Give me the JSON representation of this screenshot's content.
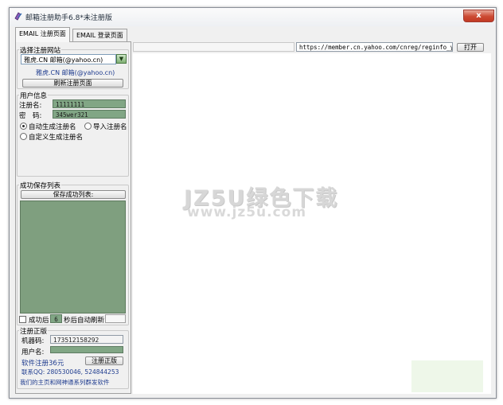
{
  "window": {
    "title": "邮箱注册助手6.8*未注册版",
    "close_label": "x"
  },
  "tabs": [
    {
      "label": "EMAIL 注册页面",
      "active": true
    },
    {
      "label": "EMAIL 登录页面",
      "active": false
    }
  ],
  "site_section": {
    "legend": "选择注册网站",
    "selected_site": "雅虎.CN 邮箱(@yahoo.cn)",
    "current_site_label": "雅虎.CN 邮箱(@yahoo.cn)",
    "refresh_button": "刷新注册页面"
  },
  "user_section": {
    "legend": "用户信息",
    "username_label": "注册名:",
    "username_value": "11111111",
    "password_label": "密　码:",
    "password_value": "345wer321",
    "radio_auto": "自动生成注册名",
    "radio_import": "导入注册名",
    "radio_custom": "自定义生成注册名",
    "selected_radio": "auto"
  },
  "save_section": {
    "legend": "成功保存列表",
    "save_button": "保存成功列表:",
    "auto_refresh_prefix": "成功后",
    "auto_refresh_seconds": "6",
    "auto_refresh_suffix": "秒后自动刷新",
    "auto_refresh_checked": false
  },
  "license_section": {
    "legend": "注册正版",
    "machine_code_label": "机器码:",
    "machine_code_value": "173512158292",
    "user_name_label": "用户名:",
    "user_name_value": "",
    "price_text": "软件注册36元",
    "register_button": "注册正版",
    "qq_text": "联系QQ: 280530046, 524844253",
    "homepage_link": "我们的主页和网神通系列群发软件"
  },
  "browser": {
    "url": "https://member.cn.yahoo.com/cnreg/reginfo_ycn.html",
    "open_button": "打开"
  },
  "watermark": {
    "line1": "JZ5U绿色下载",
    "line2": "www.jz5u.com"
  },
  "colors": {
    "field_green": "#81a685",
    "list_green": "#7f9f7f",
    "link_blue": "#1f3c8f",
    "close_red": "#c23a24"
  }
}
